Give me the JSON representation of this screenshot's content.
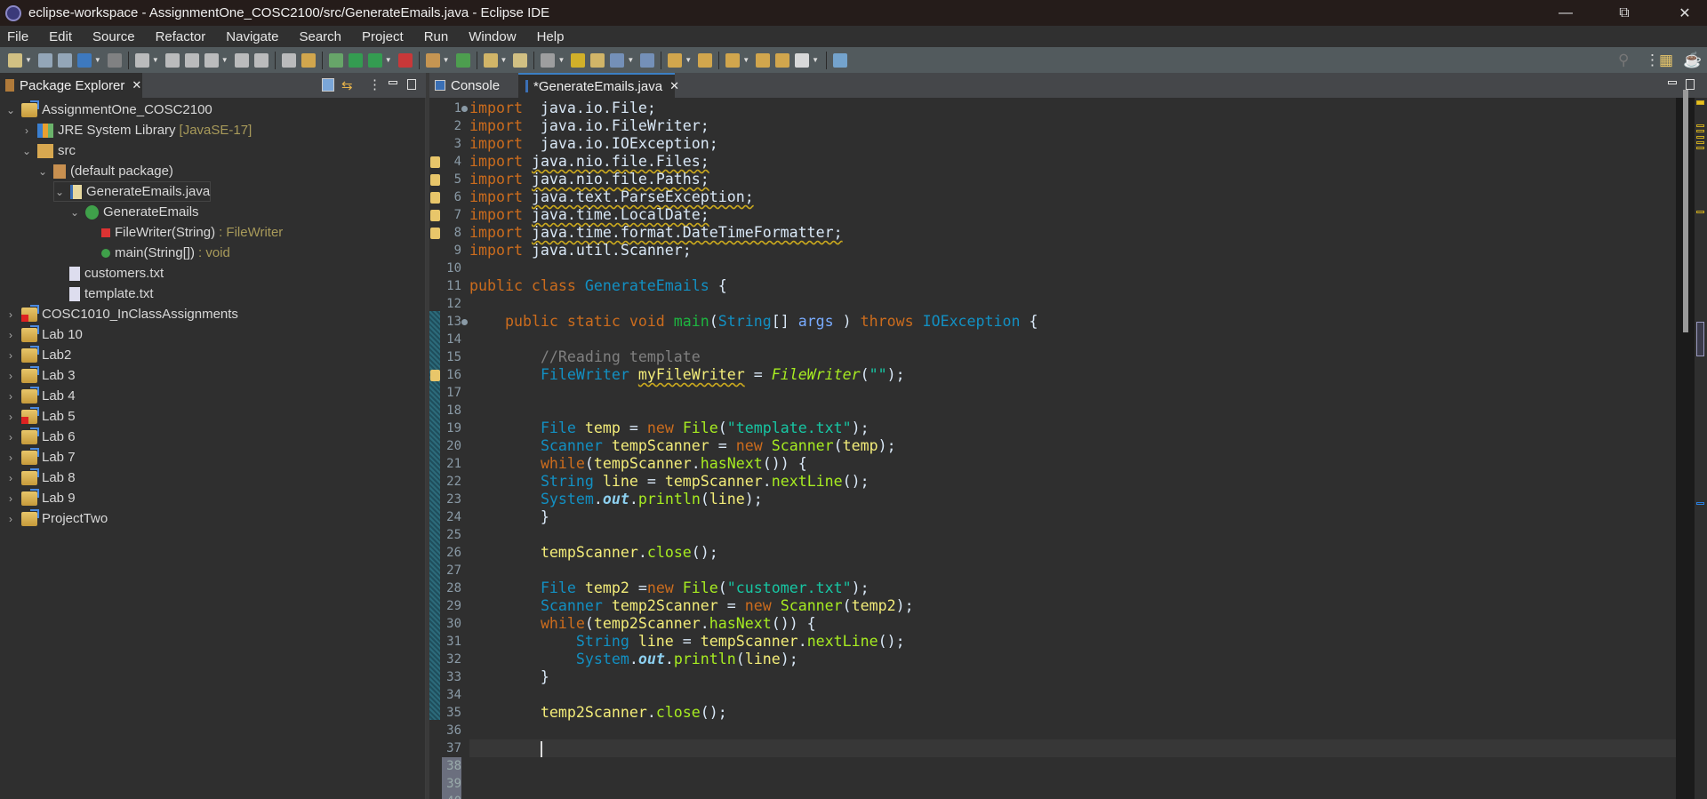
{
  "window": {
    "title": "eclipse-workspace - AssignmentOne_COSC2100/src/GenerateEmails.java - Eclipse IDE"
  },
  "menu": [
    "File",
    "Edit",
    "Source",
    "Refactor",
    "Navigate",
    "Search",
    "Project",
    "Run",
    "Window",
    "Help"
  ],
  "left_panel": {
    "tab": "Package Explorer",
    "tree": [
      {
        "label": "AssignmentOne_COSC2100",
        "depth": 0,
        "open": true,
        "icon": "project-icon"
      },
      {
        "label": "JRE System Library",
        "suffix": "[JavaSE-17]",
        "depth": 1,
        "open": false,
        "icon": "library-icon"
      },
      {
        "label": "src",
        "depth": 1,
        "open": true,
        "icon": "source-folder-icon"
      },
      {
        "label": "(default package)",
        "depth": 2,
        "open": true,
        "icon": "package-icon"
      },
      {
        "label": "GenerateEmails.java",
        "depth": 3,
        "open": true,
        "icon": "java-file-icon"
      },
      {
        "label": "GenerateEmails",
        "depth": 4,
        "open": true,
        "icon": "class-icon"
      },
      {
        "label": "FileWriter(String)",
        "suffix": ": FileWriter",
        "depth": 5,
        "icon": "method-error-icon"
      },
      {
        "label": "main(String[])",
        "suffix": ": void",
        "depth": 5,
        "icon": "method-icon"
      },
      {
        "label": "customers.txt",
        "depth": 3,
        "icon": "text-file-icon"
      },
      {
        "label": "template.txt",
        "depth": 3,
        "icon": "text-file-icon"
      },
      {
        "label": "COSC1010_InClassAssignments",
        "depth": 0,
        "open": false,
        "icon": "project-error-icon"
      },
      {
        "label": "Lab 10",
        "depth": 0,
        "open": false,
        "icon": "project-icon"
      },
      {
        "label": "Lab2",
        "depth": 0,
        "open": false,
        "icon": "project-icon"
      },
      {
        "label": "Lab 3",
        "depth": 0,
        "open": false,
        "icon": "project-icon"
      },
      {
        "label": "Lab 4",
        "depth": 0,
        "open": false,
        "icon": "project-icon"
      },
      {
        "label": "Lab 5",
        "depth": 0,
        "open": false,
        "icon": "project-error-icon"
      },
      {
        "label": "Lab 6",
        "depth": 0,
        "open": false,
        "icon": "project-icon"
      },
      {
        "label": "Lab 7",
        "depth": 0,
        "open": false,
        "icon": "project-icon"
      },
      {
        "label": "Lab 8",
        "depth": 0,
        "open": false,
        "icon": "project-icon"
      },
      {
        "label": "Lab 9",
        "depth": 0,
        "open": false,
        "icon": "project-icon"
      },
      {
        "label": "ProjectTwo",
        "depth": 0,
        "open": false,
        "icon": "project-icon"
      }
    ]
  },
  "editor": {
    "tabs": [
      {
        "label": "Console",
        "active": false
      },
      {
        "label": "*GenerateEmails.java",
        "active": true
      }
    ],
    "current_line": 37,
    "warning_lines": [
      4,
      5,
      6,
      7,
      8,
      16
    ],
    "lines": [
      [
        [
          "k",
          "import"
        ],
        [
          "",
          "  java.io.File;"
        ]
      ],
      [
        [
          "k",
          "import"
        ],
        [
          "",
          "  java.io.FileWriter;"
        ]
      ],
      [
        [
          "k",
          "import"
        ],
        [
          "",
          "  java.io.IOException;"
        ]
      ],
      [
        [
          "k",
          "import"
        ],
        [
          "",
          " "
        ],
        [
          "w",
          "java.nio.file.Files;"
        ]
      ],
      [
        [
          "k",
          "import"
        ],
        [
          "",
          " "
        ],
        [
          "w",
          "java.nio.file.Paths;"
        ]
      ],
      [
        [
          "k",
          "import"
        ],
        [
          "",
          " "
        ],
        [
          "w",
          "java.text.ParseException;"
        ]
      ],
      [
        [
          "k",
          "import"
        ],
        [
          "",
          " "
        ],
        [
          "w",
          "java.time.LocalDate;"
        ]
      ],
      [
        [
          "k",
          "import"
        ],
        [
          "",
          " "
        ],
        [
          "w",
          "java.time.format.DateTimeFormatter;"
        ]
      ],
      [
        [
          "k",
          "import"
        ],
        [
          "",
          " java.util.Scanner;"
        ]
      ],
      [],
      [
        [
          "k",
          "public class "
        ],
        [
          "t",
          "GenerateEmails"
        ],
        [
          "",
          " {"
        ]
      ],
      [],
      [
        [
          "",
          "    "
        ],
        [
          "k",
          "public static void "
        ],
        [
          "md",
          "main"
        ],
        [
          "",
          "("
        ],
        [
          "t",
          "String"
        ],
        [
          "",
          "[] "
        ],
        [
          "a",
          "args"
        ],
        [
          "",
          " ) "
        ],
        [
          "k",
          "throws "
        ],
        [
          "t",
          "IOException"
        ],
        [
          "",
          " {"
        ]
      ],
      [],
      [
        [
          "",
          "        "
        ],
        [
          "c",
          "//Reading template"
        ]
      ],
      [
        [
          "",
          "        "
        ],
        [
          "t",
          "FileWriter "
        ],
        [
          "v w",
          "myFileWriter"
        ],
        [
          "",
          " = "
        ],
        [
          "mi",
          "FileWriter"
        ],
        [
          "",
          "("
        ],
        [
          "s",
          "\"\""
        ],
        [
          "",
          ");"
        ]
      ],
      [],
      [],
      [
        [
          "",
          "        "
        ],
        [
          "t",
          "File "
        ],
        [
          "v",
          "temp"
        ],
        [
          "",
          " = "
        ],
        [
          "k",
          "new "
        ],
        [
          "m",
          "File"
        ],
        [
          "",
          "("
        ],
        [
          "s",
          "\"template.txt\""
        ],
        [
          "",
          ");"
        ]
      ],
      [
        [
          "",
          "        "
        ],
        [
          "t",
          "Scanner "
        ],
        [
          "v",
          "tempScanner"
        ],
        [
          "",
          " = "
        ],
        [
          "k",
          "new "
        ],
        [
          "m",
          "Scanner"
        ],
        [
          "",
          "("
        ],
        [
          "v",
          "temp"
        ],
        [
          "",
          ");"
        ]
      ],
      [
        [
          "",
          "        "
        ],
        [
          "k",
          "while"
        ],
        [
          "",
          "("
        ],
        [
          "v",
          "tempScanner"
        ],
        [
          "",
          "."
        ],
        [
          "m",
          "hasNext"
        ],
        [
          "",
          "()) {"
        ]
      ],
      [
        [
          "",
          "        "
        ],
        [
          "t",
          "String "
        ],
        [
          "v",
          "line"
        ],
        [
          "",
          " = "
        ],
        [
          "v",
          "tempScanner"
        ],
        [
          "",
          "."
        ],
        [
          "m",
          "nextLine"
        ],
        [
          "",
          "();"
        ]
      ],
      [
        [
          "",
          "        "
        ],
        [
          "t",
          "System"
        ],
        [
          "",
          "."
        ],
        [
          "f",
          "out"
        ],
        [
          "",
          "."
        ],
        [
          "m",
          "println"
        ],
        [
          "",
          "("
        ],
        [
          "v",
          "line"
        ],
        [
          "",
          ");"
        ]
      ],
      [
        [
          "",
          "        }"
        ]
      ],
      [],
      [
        [
          "",
          "        "
        ],
        [
          "v",
          "tempScanner"
        ],
        [
          "",
          "."
        ],
        [
          "m",
          "close"
        ],
        [
          "",
          "();"
        ]
      ],
      [],
      [
        [
          "",
          "        "
        ],
        [
          "t",
          "File "
        ],
        [
          "v",
          "temp2"
        ],
        [
          "",
          " ="
        ],
        [
          "k",
          "new "
        ],
        [
          "m",
          "File"
        ],
        [
          "",
          "("
        ],
        [
          "s",
          "\"customer.txt\""
        ],
        [
          "",
          ");"
        ]
      ],
      [
        [
          "",
          "        "
        ],
        [
          "t",
          "Scanner "
        ],
        [
          "v",
          "temp2Scanner"
        ],
        [
          "",
          " = "
        ],
        [
          "k",
          "new "
        ],
        [
          "m",
          "Scanner"
        ],
        [
          "",
          "("
        ],
        [
          "v",
          "temp2"
        ],
        [
          "",
          ");"
        ]
      ],
      [
        [
          "",
          "        "
        ],
        [
          "k",
          "while"
        ],
        [
          "",
          "("
        ],
        [
          "v",
          "temp2Scanner"
        ],
        [
          "",
          "."
        ],
        [
          "m",
          "hasNext"
        ],
        [
          "",
          "()) {"
        ]
      ],
      [
        [
          "",
          "            "
        ],
        [
          "t",
          "String "
        ],
        [
          "v",
          "line"
        ],
        [
          "",
          " = "
        ],
        [
          "v",
          "tempScanner"
        ],
        [
          "",
          "."
        ],
        [
          "m",
          "nextLine"
        ],
        [
          "",
          "();"
        ]
      ],
      [
        [
          "",
          "            "
        ],
        [
          "t",
          "System"
        ],
        [
          "",
          "."
        ],
        [
          "f",
          "out"
        ],
        [
          "",
          "."
        ],
        [
          "m",
          "println"
        ],
        [
          "",
          "("
        ],
        [
          "v",
          "line"
        ],
        [
          "",
          ");"
        ]
      ],
      [
        [
          "",
          "        }"
        ]
      ],
      [],
      [
        [
          "",
          "        "
        ],
        [
          "v",
          "temp2Scanner"
        ],
        [
          "",
          "."
        ],
        [
          "m",
          "close"
        ],
        [
          "",
          "();"
        ]
      ],
      [],
      [
        [
          "",
          "        "
        ]
      ],
      [],
      [],
      []
    ]
  }
}
